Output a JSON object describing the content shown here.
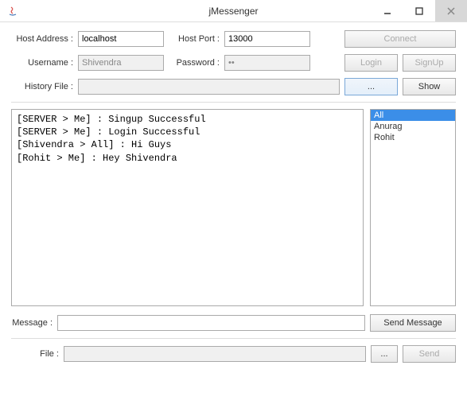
{
  "window": {
    "title": "jMessenger"
  },
  "connection": {
    "host_address_label": "Host Address :",
    "host_address_value": "localhost",
    "host_port_label": "Host Port :",
    "host_port_value": "13000",
    "connect_label": "Connect"
  },
  "auth": {
    "username_label": "Username :",
    "username_value": "Shivendra",
    "password_label": "Password :",
    "password_value": "••",
    "login_label": "Login",
    "signup_label": "SignUp"
  },
  "history": {
    "label": "History File :",
    "value": "",
    "browse_label": "...",
    "show_label": "Show"
  },
  "chat": {
    "log": "[SERVER > Me] : Singup Successful\n[SERVER > Me] : Login Successful\n[Shivendra > All] : Hi Guys\n[Rohit > Me] : Hey Shivendra",
    "users": [
      "All",
      "Anurag",
      "Rohit"
    ],
    "selected_user_index": 0
  },
  "message": {
    "label": "Message :",
    "value": "",
    "send_label": "Send Message"
  },
  "file": {
    "label": "File :",
    "value": "",
    "browse_label": "...",
    "send_label": "Send"
  }
}
